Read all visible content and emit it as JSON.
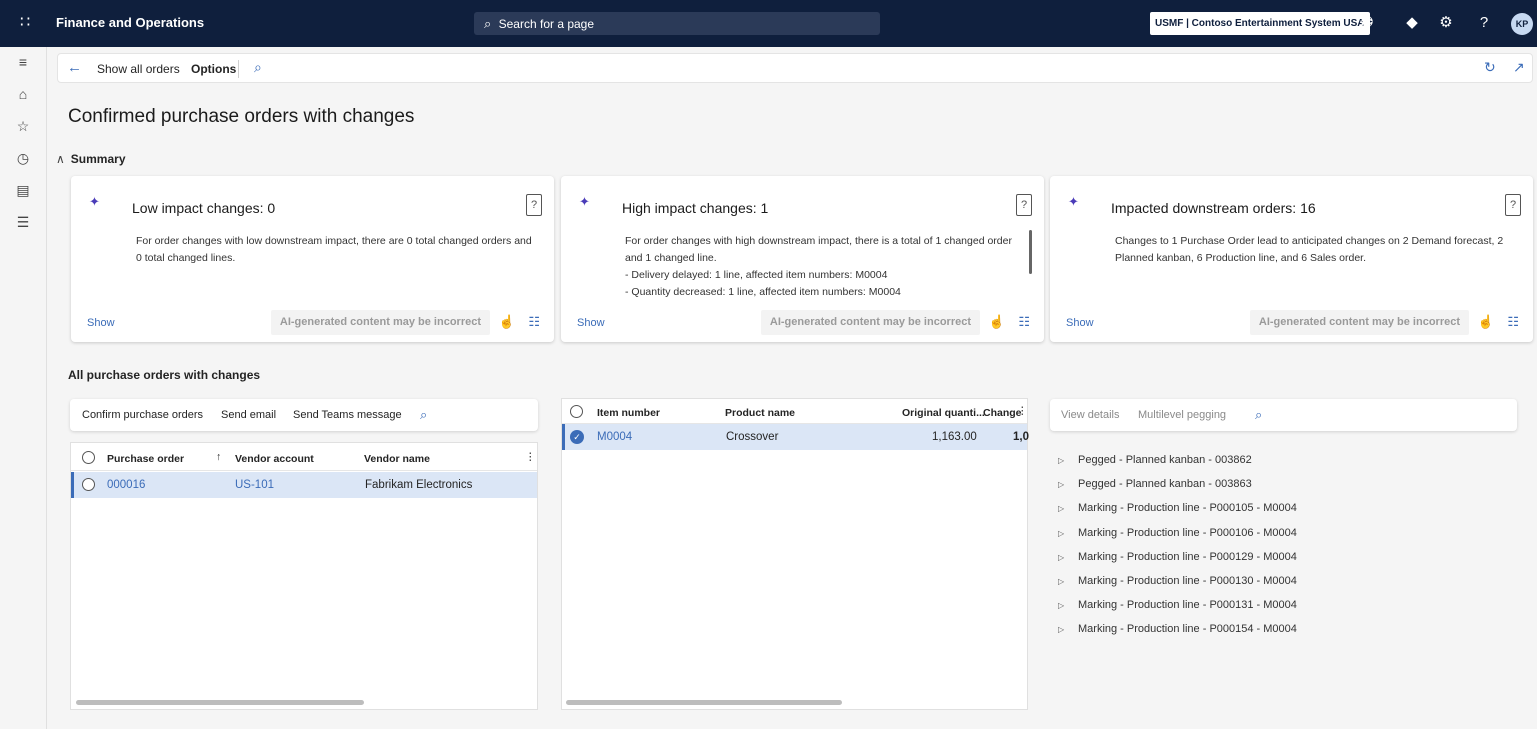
{
  "topbar": {
    "app_title": "Finance and Operations",
    "search_placeholder": "Search for a page",
    "company": "USMF | Contoso Entertainment System USA",
    "avatar_initials": "KP"
  },
  "actionbar": {
    "show_all_orders": "Show all orders",
    "options": "Options"
  },
  "page_title": "Confirmed purchase orders with changes",
  "summary": {
    "header": "Summary",
    "cards": [
      {
        "title": "Low impact changes: 0",
        "lines": [
          "For order changes with low downstream impact, there are 0 total changed orders and 0 total changed lines."
        ],
        "show": "Show",
        "ai_warning": "AI-generated content may be incorrect"
      },
      {
        "title": "High impact changes: 1",
        "lines": [
          "For order changes with high downstream impact, there is a total of 1 changed order and 1 changed line.",
          "- Delivery delayed: 1 line, affected item numbers: M0004",
          "- Quantity decreased: 1 line, affected item numbers: M0004"
        ],
        "show": "Show",
        "ai_warning": "AI-generated content may be incorrect"
      },
      {
        "title": "Impacted downstream orders: 16",
        "lines": [
          "Changes to 1 Purchase Order lead to anticipated changes on 2 Demand forecast, 2 Planned kanban, 6 Production line, and 6 Sales order."
        ],
        "show": "Show",
        "ai_warning": "AI-generated content may be incorrect"
      }
    ]
  },
  "all_orders": {
    "header": "All purchase orders with changes",
    "toolbar": {
      "confirm": "Confirm purchase orders",
      "send_email": "Send email",
      "send_teams": "Send Teams message"
    },
    "columns": {
      "purchase_order": "Purchase order",
      "vendor_account": "Vendor account",
      "vendor_name": "Vendor name"
    },
    "rows": [
      {
        "purchase_order": "000016",
        "vendor_account": "US-101",
        "vendor_name": "Fabrikam Electronics"
      }
    ]
  },
  "lines": {
    "columns": {
      "item_number": "Item number",
      "product_name": "Product name",
      "original_quantity": "Original quanti...",
      "change": "Change"
    },
    "rows": [
      {
        "item_number": "M0004",
        "product_name": "Crossover",
        "original_quantity": "1,163.00",
        "change": "1,0"
      }
    ]
  },
  "pegging": {
    "toolbar": {
      "view_details": "View details",
      "multilevel": "Multilevel pegging"
    },
    "items": [
      "Pegged - Planned kanban - 003862",
      "Pegged - Planned kanban - 003863",
      "Marking - Production line - P000105 - M0004",
      "Marking - Production line - P000106 - M0004",
      "Marking - Production line - P000129 - M0004",
      "Marking - Production line - P000130 - M0004",
      "Marking - Production line - P000131 - M0004",
      "Marking - Production line - P000154 - M0004"
    ]
  },
  "colors": {
    "topbar": "#0f1f3d",
    "accent": "#3b6cb8",
    "selected_row": "#dbe6f6"
  }
}
